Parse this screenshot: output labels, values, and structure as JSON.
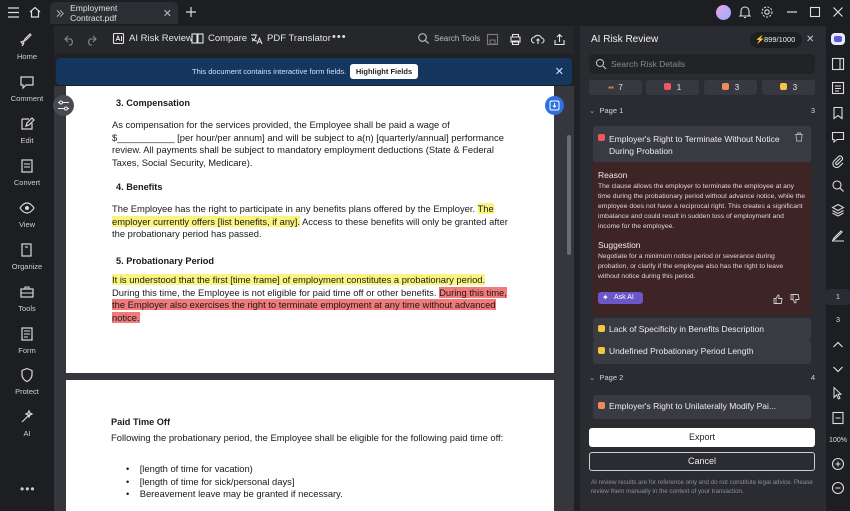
{
  "app": {
    "tab_title": "Employment Contract.pdf"
  },
  "left_sidebar": {
    "items": [
      {
        "label": "Home",
        "icon": "home-icon"
      },
      {
        "label": "Comment",
        "icon": "comment-icon"
      },
      {
        "label": "Edit",
        "icon": "edit-icon"
      },
      {
        "label": "Convert",
        "icon": "convert-icon"
      },
      {
        "label": "View",
        "icon": "view-icon"
      },
      {
        "label": "Organize",
        "icon": "organize-icon"
      },
      {
        "label": "Tools",
        "icon": "tools-icon"
      },
      {
        "label": "Form",
        "icon": "form-icon"
      },
      {
        "label": "Protect",
        "icon": "protect-icon"
      },
      {
        "label": "AI",
        "icon": "ai-icon"
      }
    ]
  },
  "toolbar": {
    "ai_risk_review": "AI Risk Review",
    "compare": "Compare",
    "pdf_translator": "PDF Translator",
    "search_tools": "Search Tools"
  },
  "banner": {
    "message": "This document contains interactive form fields.",
    "button": "Highlight Fields"
  },
  "document": {
    "section3_title": "3.   Compensation",
    "section3_body": "As compensation for the services provided, the Employee shall be paid a wage of $___________ [per hour/per annum] and will be subject to a(n) [quarterly/annual] performance review. All payments shall be subject to mandatory employment deductions (State & Federal Taxes, Social Security, Medicare).",
    "section4_title": "4.   Benefits",
    "section4_body_a": "The Employee has the right to participate in any benefits plans offered by the Employer.",
    "section4_body_hl": "The employer currently offers [list benefits, if any].",
    "section4_body_b": "Access to these benefits will only be granted after the probationary period has passed.",
    "section5_title": "5.   Probationary Period",
    "section5_hl_yellow": "It is understood that the first [time frame] of employment constitutes a probationary period.",
    "section5_body": "During this time, the Employee is not eligible for paid time off or other benefits.",
    "section5_hl_red": "During this time, the Employer also exercises the right to terminate employment at any time without advanced notice.",
    "pto_title": "Paid Time Off",
    "pto_body": "Following the probationary period, the Employee shall be eligible for the following paid time off:",
    "pto_items": [
      "[length of time for vacation)",
      "[length of time for sick/personal days]",
      "Bereavement leave may be granted if necessary."
    ]
  },
  "risk_panel": {
    "title": "AI Risk Review",
    "credits": "899/1000",
    "search_placeholder": "Search Risk Details",
    "counts": {
      "total": "7",
      "red": "1",
      "orange": "3",
      "yellow": "3"
    },
    "page1": {
      "label": "Page 1",
      "count": "3"
    },
    "expanded_card": {
      "title": "Employer's Right to Terminate Without Notice During Probation",
      "reason_heading": "Reason",
      "reason_text": "The clause allows the employer to terminate the employee at any time during the probationary period without advance notice, while the employee does not have a reciprocal right. This creates a significant imbalance and could result in sudden loss of employment and income for the employee.",
      "suggestion_heading": "Suggestion",
      "suggestion_text": "Negotiate for a minimum notice period or severance during probation, or clarify if the employee also has the right to leave without notice during this period.",
      "ask_ai": "Ask AI"
    },
    "card2": "Lack of Specificity in Benefits Description",
    "card3": "Undefined Probationary Period Length",
    "page2": {
      "label": "Page 2",
      "count": "4"
    },
    "card4": "Employer's Right to Unilaterally Modify Pai...",
    "export": "Export",
    "cancel": "Cancel",
    "disclaimer": "AI review results are for reference only and do not constitute legal advice. Please review them manually in the context of your transaction."
  },
  "right_rail": {
    "page_current": "1",
    "page_total": "3",
    "zoom": "100%"
  },
  "colors": {
    "accent": "#2f6fe0",
    "risk_red": "#f0565f",
    "risk_orange": "#f08a5d",
    "risk_yellow": "#f5c542",
    "highlight_yellow": "#fbf57f",
    "highlight_red": "#f27a7a"
  }
}
